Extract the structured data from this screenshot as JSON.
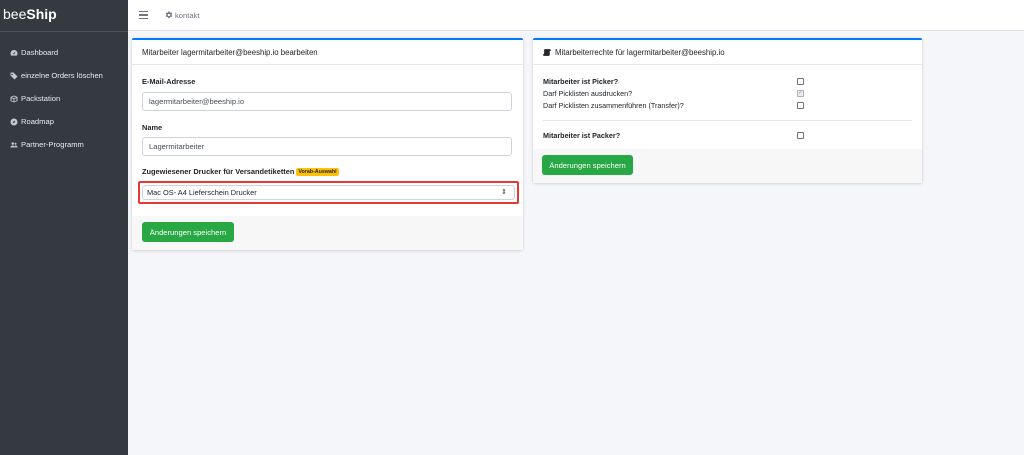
{
  "brand": {
    "light": "bee",
    "bold": "Ship"
  },
  "sidebar": {
    "items": [
      {
        "label": "Dashboard",
        "icon": "tachometer-icon"
      },
      {
        "label": "einzelne Orders löschen",
        "icon": "tag-icon"
      },
      {
        "label": "Packstation",
        "icon": "box-icon"
      },
      {
        "label": "Roadmap",
        "icon": "compass-icon"
      },
      {
        "label": "Partner-Programm",
        "icon": "users-icon"
      }
    ]
  },
  "topbar": {
    "breadcrumb": "kontakt"
  },
  "edit_card": {
    "title": "Mitarbeiter lagermitarbeiter@beeship.io bearbeiten",
    "email_label": "E-Mail-Adresse",
    "email_value": "lagermitarbeiter@beeship.io",
    "name_label": "Name",
    "name_value": "Lagermitarbeiter",
    "printer_label": "Zugewiesener Drucker für Versandetiketten",
    "printer_badge": "Vorab-Auswahl",
    "printer_selected": "Mac OS- A4 Lieferschein Drucker",
    "save_label": "Änderungen speichern"
  },
  "rights_card": {
    "title": "Mitarbeiterrechte für lagermitarbeiter@beeship.io",
    "picker_label": "Mitarbeiter ist Picker?",
    "print_picklists_label": "Darf Picklisten ausdrucken?",
    "merge_picklists_label": "Darf Picklisten zusammenführen (Transfer)?",
    "packer_label": "Mitarbeiter ist Packer?",
    "save_label": "Änderungen speichern"
  },
  "colors": {
    "sidebar": "#343a40",
    "accent": "#007bff",
    "success": "#28a745",
    "highlight": "#e53935",
    "badge": "#ffc107"
  }
}
